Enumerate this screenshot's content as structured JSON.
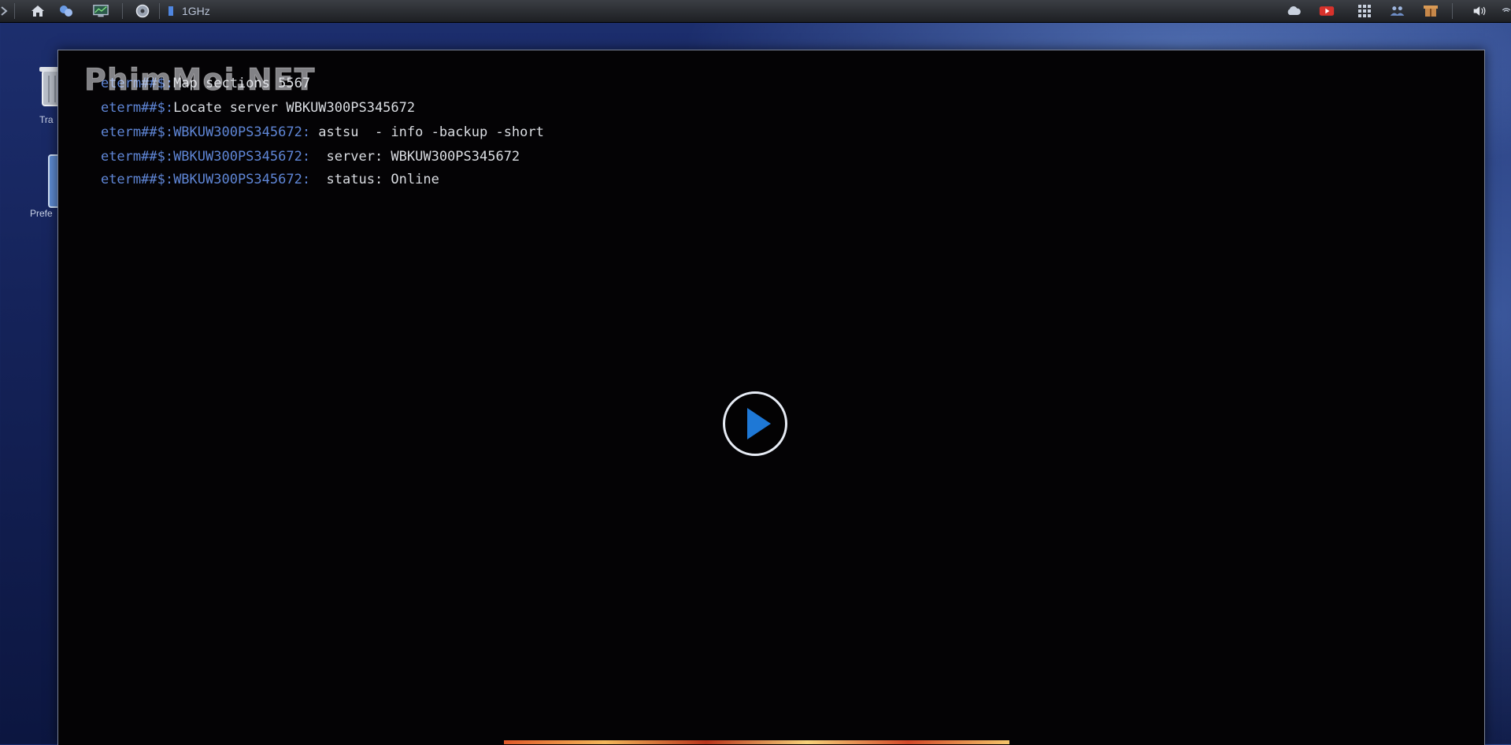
{
  "top_panel": {
    "left_icons": [
      "menu-icon",
      "home-icon",
      "network-icon",
      "monitor-icon",
      "disk-icon",
      "cpu-icon"
    ],
    "cpu_label": "1GHz",
    "tray_icons": [
      "cloud-icon",
      "media-icon",
      "apps-grid-icon",
      "users-icon",
      "package-icon",
      "volume-icon",
      "wifi-icon"
    ]
  },
  "desktop": {
    "icons": [
      {
        "name": "trash",
        "label": "Tra"
      },
      {
        "name": "preferences",
        "label": "Prefe"
      }
    ]
  },
  "watermark": {
    "text": "PhimMoi.NET"
  },
  "terminal": {
    "lines": [
      {
        "prompt": "eterm##$:",
        "text": "Map sections 5567"
      },
      {
        "prompt": "eterm##$:",
        "text": "Locate server WBKUW300PS345672"
      },
      {
        "prompt": "eterm##$:WBKUW300PS345672:",
        "text": " astsu  - info -backup -short"
      },
      {
        "prompt": "eterm##$:WBKUW300PS345672:",
        "text": "  server: WBKUW300PS345672"
      },
      {
        "prompt": "eterm##$:WBKUW300PS345672:",
        "text": "  status: Online"
      }
    ]
  },
  "player": {
    "play_icon": "play-icon",
    "accent": "#1e78d6"
  },
  "colors": {
    "prompt": "#5f86d6",
    "command": "#dadde2",
    "terminal_bg": "#040305"
  }
}
